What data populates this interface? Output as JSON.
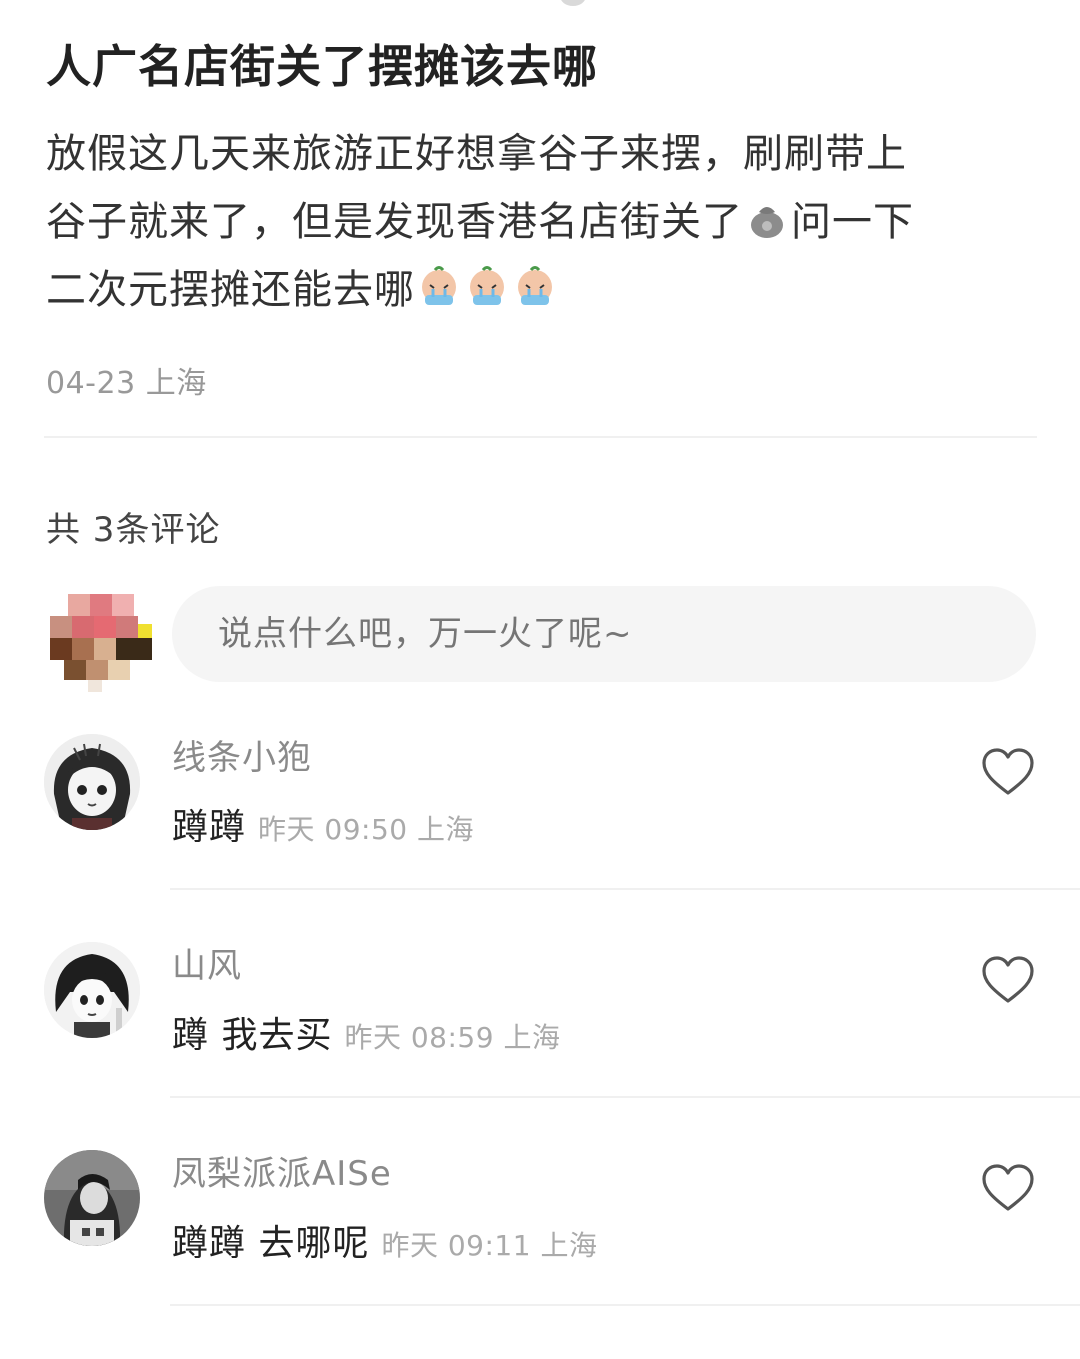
{
  "post": {
    "title": "人广名店街关了摆摊该去哪",
    "body_line1": "放假这几天来旅游正好想拿谷子来摆，刷刷带上",
    "body_line2a": "谷子就来了，但是发现香港名店街关了",
    "body_line2b": "问一下",
    "body_line3": "二次元摆摊还能去哪",
    "meta": "04-23 上海",
    "emoji_inline": "money-bag-emoji",
    "emoji_trailing": [
      "crying-face-emoji",
      "crying-face-emoji",
      "crying-face-emoji"
    ]
  },
  "comments_header": {
    "count_label": "共 3条评论"
  },
  "compose": {
    "placeholder": "说点什么吧，万一火了呢~"
  },
  "comments": [
    {
      "username": "线条小狍",
      "text": "蹲蹲",
      "time": "昨天 09:50 上海"
    },
    {
      "username": "山风",
      "text": "蹲 我去买",
      "time": "昨天 08:59 上海"
    },
    {
      "username": "凤梨派派AISe",
      "text": "蹲蹲 去哪呢",
      "time": "昨天 09:11 上海"
    }
  ],
  "icons": {
    "like": "heart-outline-icon"
  },
  "colors": {
    "text_primary": "#222222",
    "text_secondary": "#999999",
    "input_bg": "#f5f5f5",
    "divider": "#f0f0f0"
  }
}
